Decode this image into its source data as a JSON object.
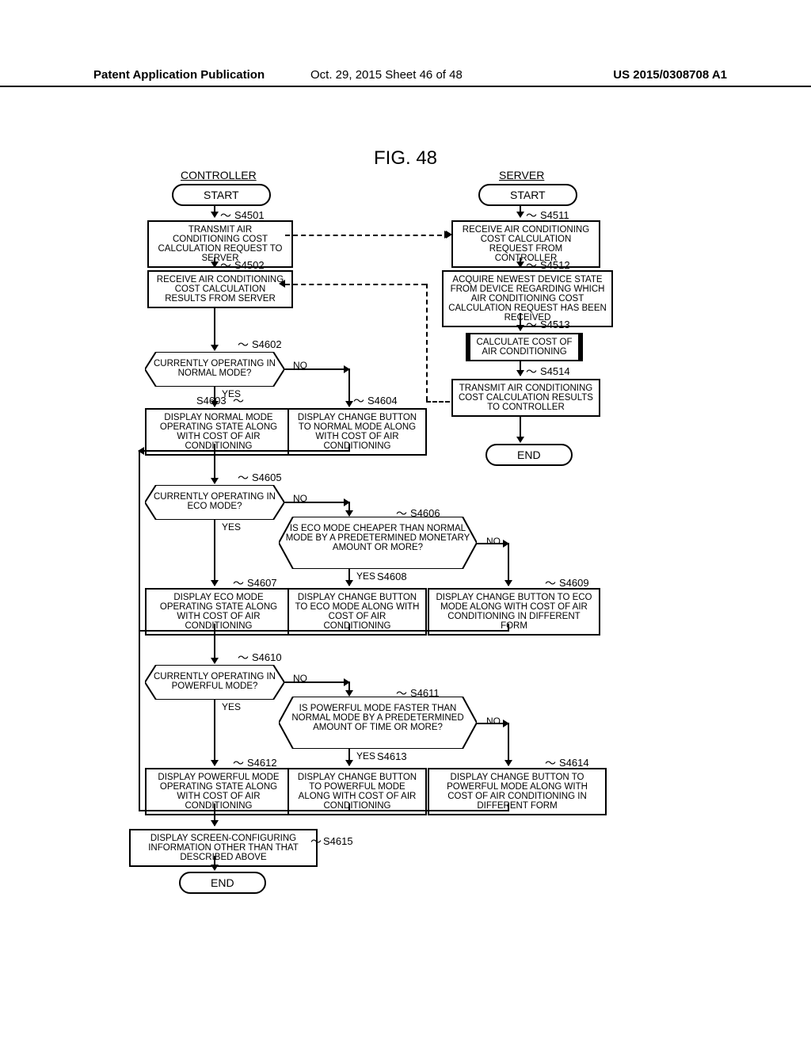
{
  "header": {
    "left": "Patent Application Publication",
    "mid": "Oct. 29, 2015  Sheet 46 of 48",
    "right": "US 2015/0308708 A1"
  },
  "figure_title": "FIG. 48",
  "columns": {
    "controller": "CONTROLLER",
    "server": "SERVER"
  },
  "common": {
    "start": "START",
    "end": "END",
    "yes": "YES",
    "no": "NO"
  },
  "controller": {
    "s4501": {
      "step": "S4501",
      "text": "TRANSMIT AIR CONDITIONING COST CALCULATION REQUEST TO SERVER"
    },
    "s4502": {
      "step": "S4502",
      "text": "RECEIVE AIR CONDITIONING COST CALCULATION RESULTS FROM SERVER"
    },
    "s4602": {
      "step": "S4602",
      "text": "CURRENTLY OPERATING IN NORMAL MODE?"
    },
    "s4603": {
      "step": "S4603",
      "text": "DISPLAY NORMAL MODE OPERATING STATE ALONG WITH COST OF AIR CONDITIONING"
    },
    "s4604": {
      "step": "S4604",
      "text": "DISPLAY CHANGE BUTTON TO NORMAL MODE ALONG WITH COST OF AIR CONDITIONING"
    },
    "s4605": {
      "step": "S4605",
      "text": "CURRENTLY OPERATING IN ECO MODE?"
    },
    "s4606": {
      "step": "S4606",
      "text": "IS ECO MODE CHEAPER THAN NORMAL MODE BY A PREDETERMINED MONETARY AMOUNT OR MORE?"
    },
    "s4607": {
      "step": "S4607",
      "text": "DISPLAY ECO MODE OPERATING STATE ALONG WITH COST OF AIR CONDITIONING"
    },
    "s4608": {
      "step": "S4608",
      "text": "DISPLAY CHANGE BUTTON TO ECO MODE ALONG WITH COST OF AIR CONDITIONING"
    },
    "s4609": {
      "step": "S4609",
      "text": "DISPLAY CHANGE BUTTON TO ECO MODE ALONG WITH COST OF AIR CONDITIONING IN DIFFERENT FORM"
    },
    "s4610": {
      "step": "S4610",
      "text": "CURRENTLY OPERATING IN POWERFUL MODE?"
    },
    "s4611": {
      "step": "S4611",
      "text": "IS POWERFUL MODE FASTER THAN NORMAL MODE BY A PREDETERMINED AMOUNT OF TIME OR MORE?"
    },
    "s4612": {
      "step": "S4612",
      "text": "DISPLAY POWERFUL MODE OPERATING STATE ALONG WITH COST OF AIR CONDITIONING"
    },
    "s4613": {
      "step": "S4613",
      "text": "DISPLAY CHANGE BUTTON TO POWERFUL MODE ALONG WITH COST OF AIR CONDITIONING"
    },
    "s4614": {
      "step": "S4614",
      "text": "DISPLAY CHANGE BUTTON TO POWERFUL MODE ALONG WITH COST OF AIR CONDITIONING IN DIFFERENT FORM"
    },
    "s4615": {
      "step": "S4615",
      "text": "DISPLAY SCREEN-CONFIGURING INFORMATION OTHER THAN THAT DESCRIBED ABOVE"
    }
  },
  "server": {
    "s4511": {
      "step": "S4511",
      "text": "RECEIVE AIR CONDITIONING COST CALCULATION REQUEST FROM CONTROLLER"
    },
    "s4512": {
      "step": "S4512",
      "text": "ACQUIRE NEWEST DEVICE STATE FROM DEVICE REGARDING WHICH AIR CONDITIONING COST CALCULATION REQUEST HAS BEEN RECEIVED"
    },
    "s4513": {
      "step": "S4513",
      "text": "CALCULATE COST OF AIR CONDITIONING"
    },
    "s4514": {
      "step": "S4514",
      "text": "TRANSMIT AIR CONDITIONING COST CALCULATION RESULTS TO CONTROLLER"
    }
  }
}
